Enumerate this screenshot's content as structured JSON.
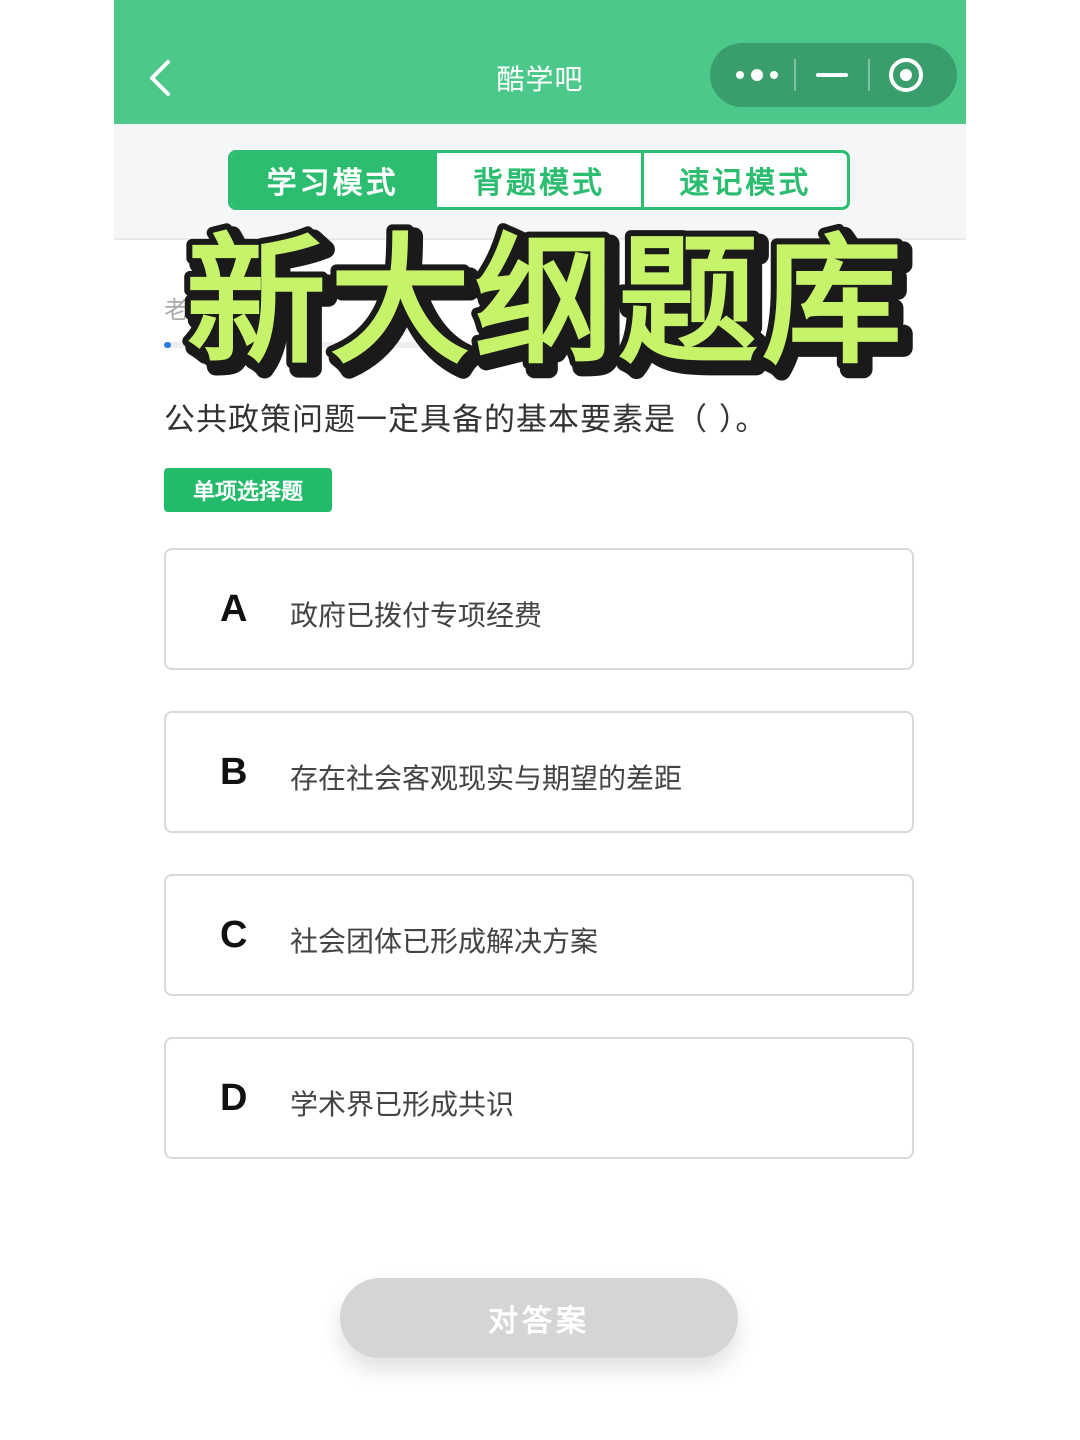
{
  "nav": {
    "title": "酷学吧"
  },
  "mode_tabs": [
    {
      "label": "学习模式",
      "active": true
    },
    {
      "label": "背题模式",
      "active": false
    },
    {
      "label": "速记模式",
      "active": false
    }
  ],
  "overlay_title": "新大纲题库",
  "breadcrumb_visible": "老     诊断     的",
  "question": {
    "text": "公共政策问题一定具备的基本要素是（    ）。",
    "type_badge": "单项选择题"
  },
  "options": [
    {
      "letter": "A",
      "text": "政府已拨付专项经费"
    },
    {
      "letter": "B",
      "text": "存在社会客观现实与期望的差距"
    },
    {
      "letter": "C",
      "text": "社会团体已形成解决方案"
    },
    {
      "letter": "D",
      "text": "学术界已形成共识"
    }
  ],
  "submit_label": "对答案",
  "icons": {
    "back": "chevron-left-icon",
    "more": "more-dots-icon",
    "minimize": "minimize-icon",
    "close": "close-target-icon"
  },
  "colors": {
    "nav_green": "#4cc98a",
    "accent_green": "#2dbd70",
    "overlay_fill": "#c6f36a",
    "progress_blue": "#2a7be4",
    "submit_disabled": "#d5d5d5"
  },
  "progress_fraction": 0.01
}
